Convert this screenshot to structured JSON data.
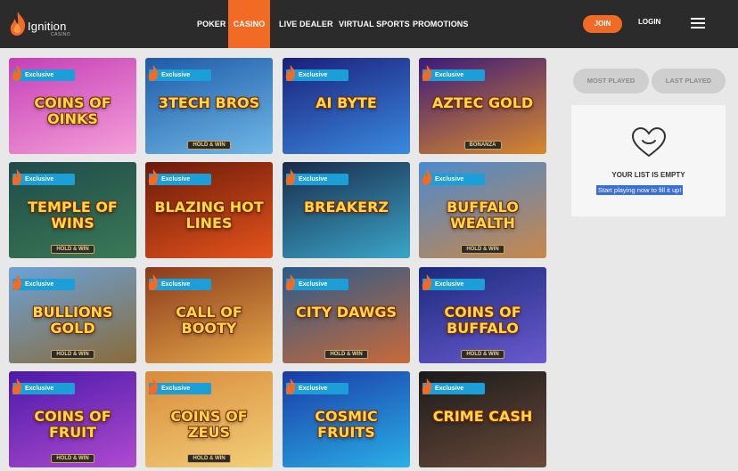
{
  "brand": {
    "name": "Ignition",
    "sub": "CASINO"
  },
  "nav": [
    {
      "label": "POKER"
    },
    {
      "label": "CASINO"
    },
    {
      "label": "LIVE DEALER"
    },
    {
      "label": "VIRTUAL SPORTS"
    },
    {
      "label": "PROMOTIONS"
    }
  ],
  "auth": {
    "join": "JOIN",
    "login": "LOGIN"
  },
  "badge": "Exclusive",
  "games": [
    {
      "title": "COINS OF OINKS",
      "sub": "",
      "bg": [
        "#c53fb8",
        "#f5a0d8"
      ]
    },
    {
      "title": "3TECH BROS",
      "sub": "HOLD & WIN",
      "bg": [
        "#1e5aa8",
        "#6fb8e6"
      ]
    },
    {
      "title": "AI BYTE",
      "sub": "",
      "bg": [
        "#1b1f7a",
        "#3a8ae0"
      ]
    },
    {
      "title": "AZTEC GOLD",
      "sub": "BONANZA",
      "bg": [
        "#3b1a7a",
        "#d9892c"
      ]
    },
    {
      "title": "TEMPLE OF WINS",
      "sub": "HOLD & WIN",
      "bg": [
        "#1f4a4a",
        "#3a7a55"
      ]
    },
    {
      "title": "BLAZING HOT LINES",
      "sub": "",
      "bg": [
        "#6a1a0a",
        "#e6541c"
      ]
    },
    {
      "title": "BREAKERZ",
      "sub": "",
      "bg": [
        "#1a2a4a",
        "#3aa6c9"
      ]
    },
    {
      "title": "BUFFALO WEALTH",
      "sub": "HOLD & WIN",
      "bg": [
        "#4a8ad0",
        "#c9874a"
      ]
    },
    {
      "title": "BULLIONS GOLD",
      "sub": "HOLD & WIN",
      "bg": [
        "#6aa3d9",
        "#8a6a3a"
      ]
    },
    {
      "title": "CALL OF BOOTY",
      "sub": "",
      "bg": [
        "#8a3a1a",
        "#e6a64a"
      ]
    },
    {
      "title": "CITY DAWGS",
      "sub": "HOLD & WIN",
      "bg": [
        "#2a5a8a",
        "#c96a3a"
      ]
    },
    {
      "title": "COINS OF BUFFALO",
      "sub": "HOLD & WIN",
      "bg": [
        "#1a2a7a",
        "#6a5ad0"
      ]
    },
    {
      "title": "COINS OF FRUIT",
      "sub": "HOLD & WIN",
      "bg": [
        "#4a1aa8",
        "#b04ad0"
      ]
    },
    {
      "title": "COINS OF ZEUS",
      "sub": "HOLD & WIN",
      "bg": [
        "#d98a3a",
        "#f2d07a"
      ]
    },
    {
      "title": "COSMIC FRUITS",
      "sub": "",
      "bg": [
        "#1a3aa8",
        "#2ab0e6"
      ]
    },
    {
      "title": "CRIME CASH",
      "sub": "",
      "bg": [
        "#1a1a1a",
        "#6a4a3a"
      ]
    }
  ],
  "sidebar": {
    "tabs": [
      {
        "label": "MOST PLAYED"
      },
      {
        "label": "LAST PLAYED"
      }
    ],
    "empty_title": "YOUR LIST IS EMPTY",
    "empty_sub": "Start playing now to fill it up!"
  },
  "colors": {
    "accent": "#f26b25",
    "header": "#2b2b2b",
    "badge": "#1c9ed9"
  }
}
